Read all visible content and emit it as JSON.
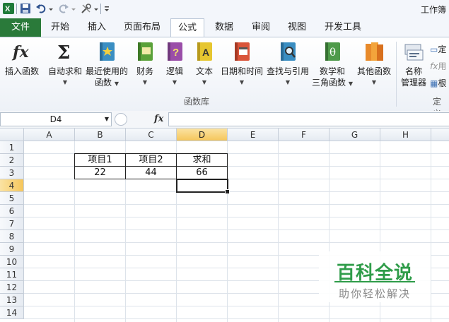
{
  "window": {
    "title": "工作簿"
  },
  "qat": {
    "icons": [
      "excel-logo-icon",
      "save-icon",
      "undo-icon",
      "redo-icon",
      "tools-icon",
      "customize-icon"
    ]
  },
  "tabs": {
    "file": "文件",
    "items": [
      "开始",
      "插入",
      "页面布局",
      "公式",
      "数据",
      "审阅",
      "视图",
      "开发工具"
    ],
    "active": "公式"
  },
  "ribbon": {
    "insert_function": "插入函数",
    "autosum": "自动求和",
    "recent_1": "最近使用的",
    "recent_2": "函数",
    "financial": "财务",
    "logical": "逻辑",
    "text": "文本",
    "datetime": "日期和时间",
    "lookup": "查找与引用",
    "math_1": "数学和",
    "math_2": "三角函数",
    "more": "其他函数",
    "name_mgr_1": "名称",
    "name_mgr_2": "管理器",
    "group_library": "函数库",
    "define_name": "定",
    "use_in_formula": "用",
    "create_from": "根",
    "group_defined": "定义"
  },
  "formula_bar": {
    "name_box": "D4",
    "fx": "fx",
    "content": ""
  },
  "grid": {
    "columns": [
      "A",
      "B",
      "C",
      "D",
      "E",
      "F",
      "G",
      "H"
    ],
    "selected_column": "D",
    "rows": [
      "1",
      "2",
      "3",
      "4",
      "5",
      "6",
      "7",
      "8",
      "9",
      "10",
      "11",
      "12",
      "13",
      "14"
    ],
    "selected_row": "4",
    "cells": {
      "B2": "项目1",
      "C2": "项目2",
      "D2": "求和",
      "B3": "22",
      "C3": "44",
      "D3": "66"
    }
  },
  "watermark": {
    "title": "百科全说",
    "subtitle": "助你轻松解决"
  },
  "colors": {
    "file_tab": "#2a7a3a",
    "selection_header": "#f5c65b",
    "watermark_green": "#2f9c49"
  }
}
